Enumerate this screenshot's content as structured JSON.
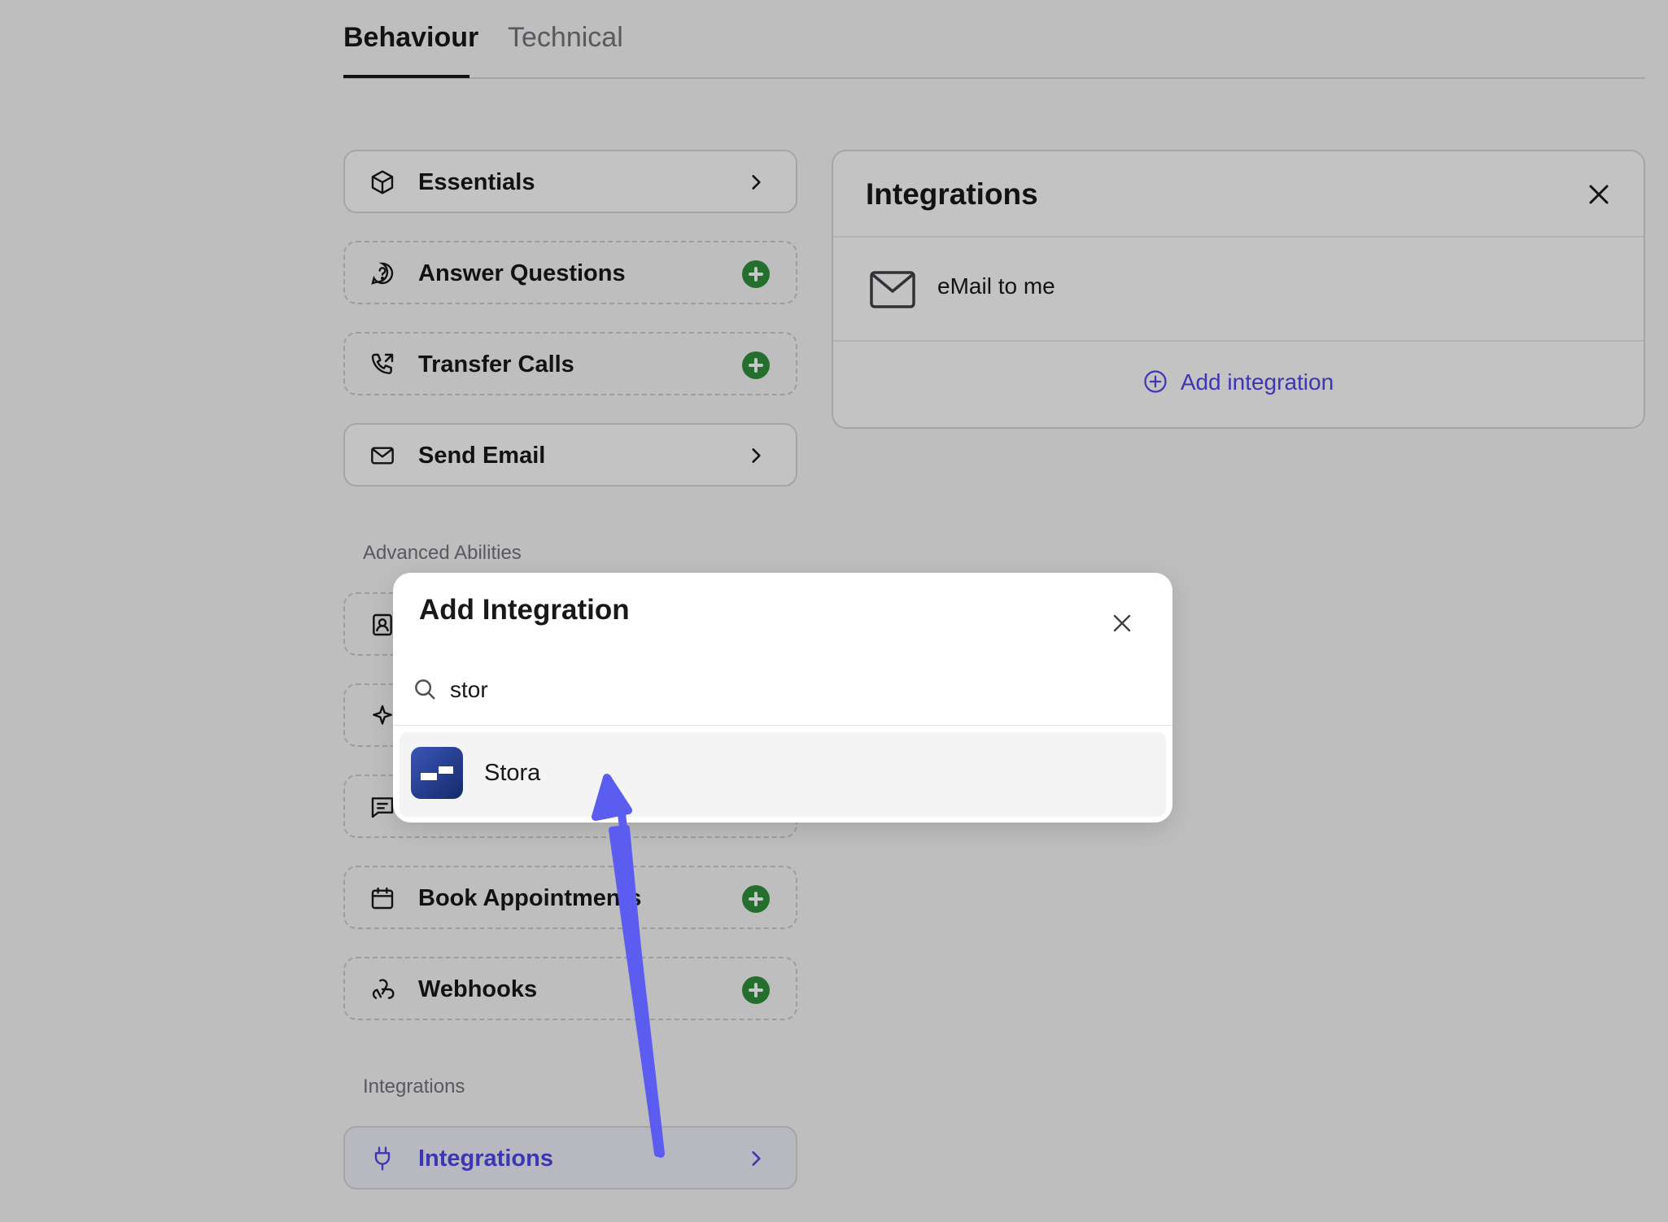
{
  "tabs": [
    {
      "label": "Behaviour",
      "active": true
    },
    {
      "label": "Technical",
      "active": false
    }
  ],
  "abilities": [
    {
      "label": "Essentials",
      "icon": "cube-icon",
      "action": "chevron"
    },
    {
      "label": "Answer Questions",
      "icon": "question-bubble-icon",
      "action": "add"
    },
    {
      "label": "Transfer Calls",
      "icon": "phone-transfer-icon",
      "action": "add"
    },
    {
      "label": "Send Email",
      "icon": "mail-icon",
      "action": "chevron"
    }
  ],
  "sections": {
    "advanced": "Advanced Abilities",
    "integrations": "Integrations"
  },
  "advanced_abilities": [
    {
      "label": "Book Appointments",
      "icon": "calendar-icon",
      "action": "add"
    },
    {
      "label": "Webhooks",
      "icon": "webhook-icon",
      "action": "add"
    }
  ],
  "integrations_item": {
    "label": "Integrations",
    "icon": "plug-icon",
    "action": "chevron"
  },
  "panel": {
    "title": "Integrations",
    "item": "eMail to me",
    "add_label": "Add integration"
  },
  "modal": {
    "title": "Add Integration",
    "search_value": "stor",
    "result": "Stora"
  },
  "colors": {
    "accent": "#4f46e5",
    "add_green": "#2f8f3a",
    "arrow": "#5b5cf0"
  }
}
